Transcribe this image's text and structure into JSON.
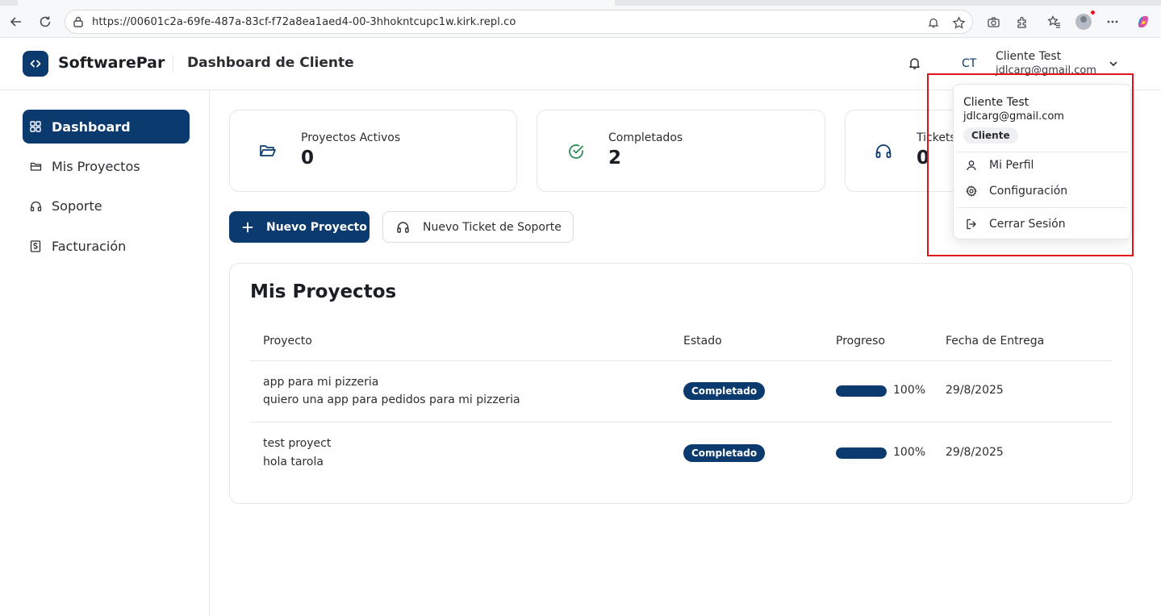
{
  "browser": {
    "url": "https://00601c2a-69fe-487a-83cf-f72a8ea1aed4-00-3hhokntcupc1w.kirk.repl.co"
  },
  "header": {
    "brand": "SoftwarePar",
    "page_title": "Dashboard de Cliente",
    "user_initials": "CT",
    "user_name": "Cliente Test",
    "user_email": "jdlcarg@gmail.com"
  },
  "sidebar": {
    "items": [
      {
        "label": "Dashboard",
        "icon": "grid-icon",
        "active": true
      },
      {
        "label": "Mis Proyectos",
        "icon": "folder-icon",
        "active": false
      },
      {
        "label": "Soporte",
        "icon": "headphones-icon",
        "active": false
      },
      {
        "label": "Facturación",
        "icon": "dollar-receipt-icon",
        "active": false
      }
    ]
  },
  "stats": [
    {
      "label": "Proyectos Activos",
      "value": "0",
      "icon": "folder-open-icon"
    },
    {
      "label": "Completados",
      "value": "2",
      "icon": "check-circle-icon"
    },
    {
      "label": "Tickets",
      "value": "0",
      "icon": "headphones-icon"
    }
  ],
  "actions": {
    "new_project": "Nuevo Proyecto",
    "new_ticket": "Nuevo Ticket de Soporte"
  },
  "projects": {
    "title": "Mis Proyectos",
    "columns": [
      "Proyecto",
      "Estado",
      "Progreso",
      "Fecha de Entrega"
    ],
    "rows": [
      {
        "name": "app para mi pizzeria",
        "description": "quiero una app para pedidos para mi pizzeria",
        "status": "Completado",
        "progress": 100,
        "progress_label": "100%",
        "due_date": "29/8/2025"
      },
      {
        "name": "test proyect",
        "description": "hola tarola",
        "status": "Completado",
        "progress": 100,
        "progress_label": "100%",
        "due_date": "29/8/2025"
      }
    ]
  },
  "user_menu": {
    "name": "Cliente Test",
    "email": "jdlcarg@gmail.com",
    "role": "Cliente",
    "items": [
      {
        "label": "Mi Perfil",
        "icon": "user-icon"
      },
      {
        "label": "Configuración",
        "icon": "gear-icon"
      },
      {
        "label": "Cerrar Sesión",
        "icon": "logout-icon"
      }
    ]
  },
  "colors": {
    "primary": "#0b3a6e",
    "success": "#2e8b57",
    "highlight": "#e3121b"
  }
}
